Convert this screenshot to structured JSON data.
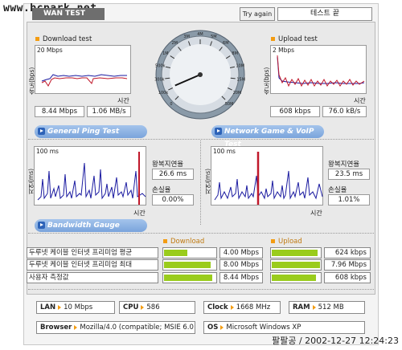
{
  "watermark": "www.bcpark.net",
  "header": {
    "title": "WAN TEST",
    "try_again": "Try again",
    "result": "테스트 끝"
  },
  "download": {
    "title": "Download test",
    "ylabel": "속도(bps)",
    "scale": "20 Mbps",
    "xlabel": "시간",
    "mbps": "8.44 Mbps",
    "mbs": "1.06 MB/s"
  },
  "upload": {
    "title": "Upload test",
    "ylabel": "속도(bps)",
    "scale": "2 Mbps",
    "xlabel": "시간",
    "kbps": "608 kbps",
    "kbs": "76.0 kB/s"
  },
  "gauge": {
    "ticks": [
      "0",
      "100k",
      "300k",
      "500k",
      "1M",
      "2M",
      "3M",
      "4M",
      "5M",
      "6M",
      "8M",
      "10M",
      "15M",
      "20M",
      "50M"
    ],
    "needle_fraction": 0.08
  },
  "ping_general": {
    "label": "General Ping Test",
    "ylabel": "지연(ms)",
    "scale": "100 ms",
    "xlabel": "시간",
    "rtt_label": "왕복지연율",
    "rtt": "26.6 ms",
    "loss_label": "손실율",
    "loss": "0.00%"
  },
  "ping_game": {
    "label": "Network Game & VoIP Test",
    "ylabel": "지연(ms)",
    "scale": "100 ms",
    "xlabel": "시간",
    "rtt_label": "왕복지연율",
    "rtt": "23.5 ms",
    "loss_label": "손실율",
    "loss": "1.01%"
  },
  "bandwidth": {
    "label": "Bandwidth Gauge",
    "download_header": "Download",
    "upload_header": "Upload",
    "rows": [
      {
        "name": "두루넷 케이블 인터넷 프리미엄 평균",
        "down": "4.00 Mbps",
        "down_fraction": 0.45,
        "up": "624 kbps",
        "up_fraction": 0.95
      },
      {
        "name": "두루넷 케이블 인터넷 프리미엄 최대",
        "down": "8.00 Mbps",
        "down_fraction": 0.9,
        "up": "7.96 Mbps",
        "up_fraction": 1.0
      },
      {
        "name": "사용자 측정값",
        "down": "8.44 Mbps",
        "down_fraction": 0.93,
        "up": "608 kbps",
        "up_fraction": 0.92
      }
    ]
  },
  "info": {
    "lan_label": "LAN",
    "lan": "10 Mbps",
    "cpu_label": "CPU",
    "cpu": "586",
    "clock_label": "Clock",
    "clock": "1668 MHz",
    "ram_label": "RAM",
    "ram": "512 MB",
    "browser_label": "Browser",
    "browser": "Mozilla/4.0 (compatible; MSIE 6.0",
    "os_label": "OS",
    "os": "Microsoft Windows XP"
  },
  "footer_stamp": "팔팔공 / 2002-12-27 12:24:23",
  "colors": {
    "accent": "#f39c12",
    "series_red": "#c0182a",
    "series_blue": "#1a1aa0",
    "bar_green": "#9acc1c",
    "pill_blue": "#7aa4dc"
  }
}
